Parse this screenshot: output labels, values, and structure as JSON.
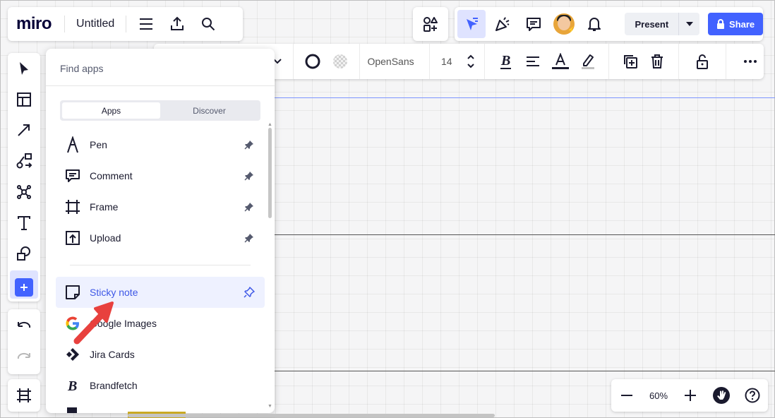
{
  "header": {
    "logo": "miro",
    "board_title": "Untitled",
    "present_label": "Present",
    "share_label": "Share"
  },
  "format_toolbar": {
    "font_name": "OpenSans",
    "font_size": "14"
  },
  "apps_panel": {
    "search_placeholder": "Find apps",
    "tabs": [
      {
        "label": "Apps",
        "active": true
      },
      {
        "label": "Discover",
        "active": false
      }
    ],
    "pinned": [
      {
        "label": "Pen",
        "icon": "pen-icon"
      },
      {
        "label": "Comment",
        "icon": "comment-icon"
      },
      {
        "label": "Frame",
        "icon": "frame-icon"
      },
      {
        "label": "Upload",
        "icon": "upload-icon"
      }
    ],
    "others": [
      {
        "label": "Sticky note",
        "icon": "sticky-note-icon",
        "highlighted": true
      },
      {
        "label": "Google Images",
        "icon": "google-icon"
      },
      {
        "label": "Jira Cards",
        "icon": "jira-icon"
      },
      {
        "label": "Brandfetch",
        "icon": "brandfetch-icon"
      }
    ]
  },
  "zoom": {
    "level": "60%"
  },
  "colors": {
    "accent": "#4262ff",
    "highlight_bg": "#eef1ff",
    "annotation_arrow": "#e8413e"
  }
}
